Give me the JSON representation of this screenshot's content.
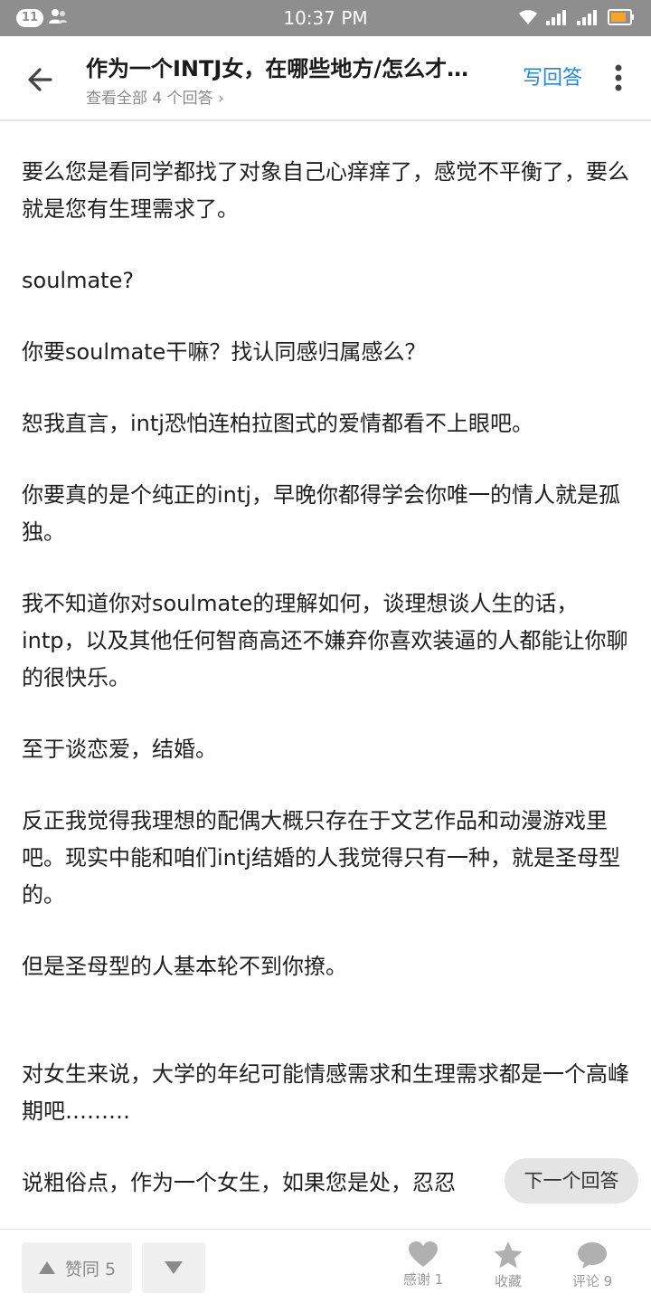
{
  "status_bar": {
    "notification_count": "11",
    "time": "10:37 PM"
  },
  "header": {
    "title": "作为一个INTJ女，在哪些地方/怎么才…",
    "subtitle": "查看全部 4 个回答 ›",
    "write_answer": "写回答"
  },
  "answer": {
    "paragraphs": [
      "要么您是看同学都找了对象自己心痒痒了，感觉不平衡了，要么就是您有生理需求了。",
      "soulmate?",
      "你要soulmate干嘛？找认同感归属感么？",
      "恕我直言，intj恐怕连柏拉图式的爱情都看不上眼吧。",
      "你要真的是个纯正的intj，早晚你都得学会你唯一的情人就是孤独。",
      "我不知道你对soulmate的理解如何，谈理想谈人生的话，intp，以及其他任何智商高还不嫌弃你喜欢装逼的人都能让你聊的很快乐。",
      "至于谈恋爱，结婚。",
      "反正我觉得我理想的配偶大概只存在于文艺作品和动漫游戏里吧。现实中能和咱们intj结婚的人我觉得只有一种，就是圣母型的。",
      "但是圣母型的人基本轮不到你撩。",
      "对女生来说，大学的年纪可能情感需求和生理需求都是一个高峰期吧………",
      "说粗俗点，作为一个女生，如果您是处，忍忍"
    ]
  },
  "next_answer_label": "下一个回答",
  "bottom_bar": {
    "vote_up_label": "赞同 5",
    "thanks_label": "感谢 1",
    "favorite_label": "收藏",
    "comment_label": "评论 9"
  },
  "colors": {
    "accent": "#1e88e5",
    "status_bar": "#8e8e8e"
  },
  "icons": [
    "back-arrow-icon",
    "more-vert-icon",
    "triangle-up-icon",
    "triangle-down-icon",
    "heart-icon",
    "star-icon",
    "chat-bubble-icon",
    "wifi-icon",
    "signal-icon",
    "battery-icon",
    "contacts-icon"
  ]
}
